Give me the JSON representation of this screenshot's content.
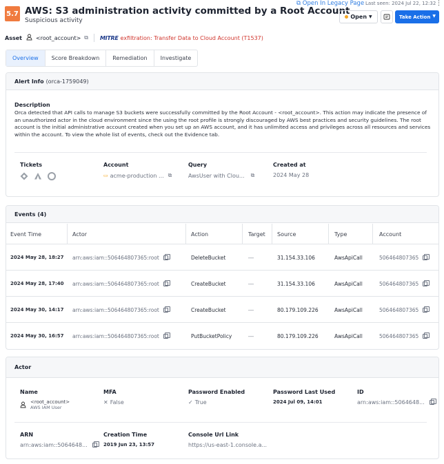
{
  "header": {
    "score": "5.7",
    "title": "AWS: S3 administration activity committed by a Root Account",
    "subtitle": "Suspicious activity",
    "legacy_link": "Open In Legacy Page",
    "last_seen": "Last seen: 2024 Jul 22, 12:32",
    "status": "Open",
    "action_label": "Take Action",
    "colors": {
      "score_bg": "#f07b3f",
      "primary": "#1a6fe8",
      "status_dot": "#f5a623"
    }
  },
  "asset": {
    "label": "Asset",
    "value": "<root_account>",
    "mitre_logo": "MITRE",
    "mitre_text": "exfiltration: Transfer Data to Cloud Account (T1537)"
  },
  "tabs": [
    "Overview",
    "Score Breakdown",
    "Remediation",
    "Investigate"
  ],
  "alert_info": {
    "title": "Alert Info",
    "id": "(orca-1759049)",
    "description_title": "Description",
    "description": "Orca detected that API calls to manage S3 buckets were successfully committed by the Root Account - <root_account>. This action may indicate the presence of an unauthorized actor in the cloud environment since the using the root profile is strongly discouraged by AWS best practices and security guidelines. The root account is the initial administrative account created when you set up an AWS account, and it has unlimited access and privileges across all resources and services within the account. To view the whole list of events, check out the Evidence tab.",
    "tickets_label": "Tickets",
    "ticket_icons": [
      "jira-icon",
      "atlassian-icon",
      "servicenow-icon"
    ],
    "account_label": "Account",
    "account_value": "acme-production ...",
    "query_label": "Query",
    "query_value": "AwsUser with Clou...",
    "created_label": "Created at",
    "created_value": "2024 May 28"
  },
  "events": {
    "title": "Events",
    "count": "(4)",
    "columns": [
      "Event Time",
      "Actor",
      "Action",
      "Target",
      "Source",
      "Type",
      "Account"
    ],
    "rows": [
      {
        "time": "2024 May 28, 18:27",
        "actor": "arn:aws:iam::506464807365:root",
        "action": "DeleteBucket",
        "target": "---",
        "source": "31.154.33.106",
        "type": "AwsApiCall",
        "account": "506464807365"
      },
      {
        "time": "2024 May 28, 17:40",
        "actor": "arn:aws:iam::506464807365:root",
        "action": "CreateBucket",
        "target": "---",
        "source": "31.154.33.106",
        "type": "AwsApiCall",
        "account": "506464807365"
      },
      {
        "time": "2024 May 30, 14:17",
        "actor": "arn:aws:iam::506464807365:root",
        "action": "CreateBucket",
        "target": "---",
        "source": "80.179.109.226",
        "type": "AwsApiCall",
        "account": "506464807365"
      },
      {
        "time": "2024 May 30, 16:57",
        "actor": "arn:aws:iam::506464807365:root",
        "action": "PutBucketPolicy",
        "target": "---",
        "source": "80.179.109.226",
        "type": "AwsApiCall",
        "account": "506464807365"
      }
    ]
  },
  "actor": {
    "title": "Actor",
    "name_label": "Name",
    "name_value": "<root_account>",
    "name_sub": "AWS IAM User",
    "mfa_label": "MFA",
    "mfa_value": "False",
    "pw_enabled_label": "Password Enabled",
    "pw_enabled_value": "True",
    "pw_last_used_label": "Password Last Used",
    "pw_last_used_value": "2024 Jul 09, 14:01",
    "id_label": "ID",
    "id_value": "arn:aws:iam::5064648...",
    "arn_label": "ARN",
    "arn_value": "arn:aws:iam::5064648...",
    "creation_label": "Creation Time",
    "creation_value": "2019 Jun 23, 13:57",
    "console_label": "Console Url Link",
    "console_value": "https://us-east-1.console.a..."
  }
}
